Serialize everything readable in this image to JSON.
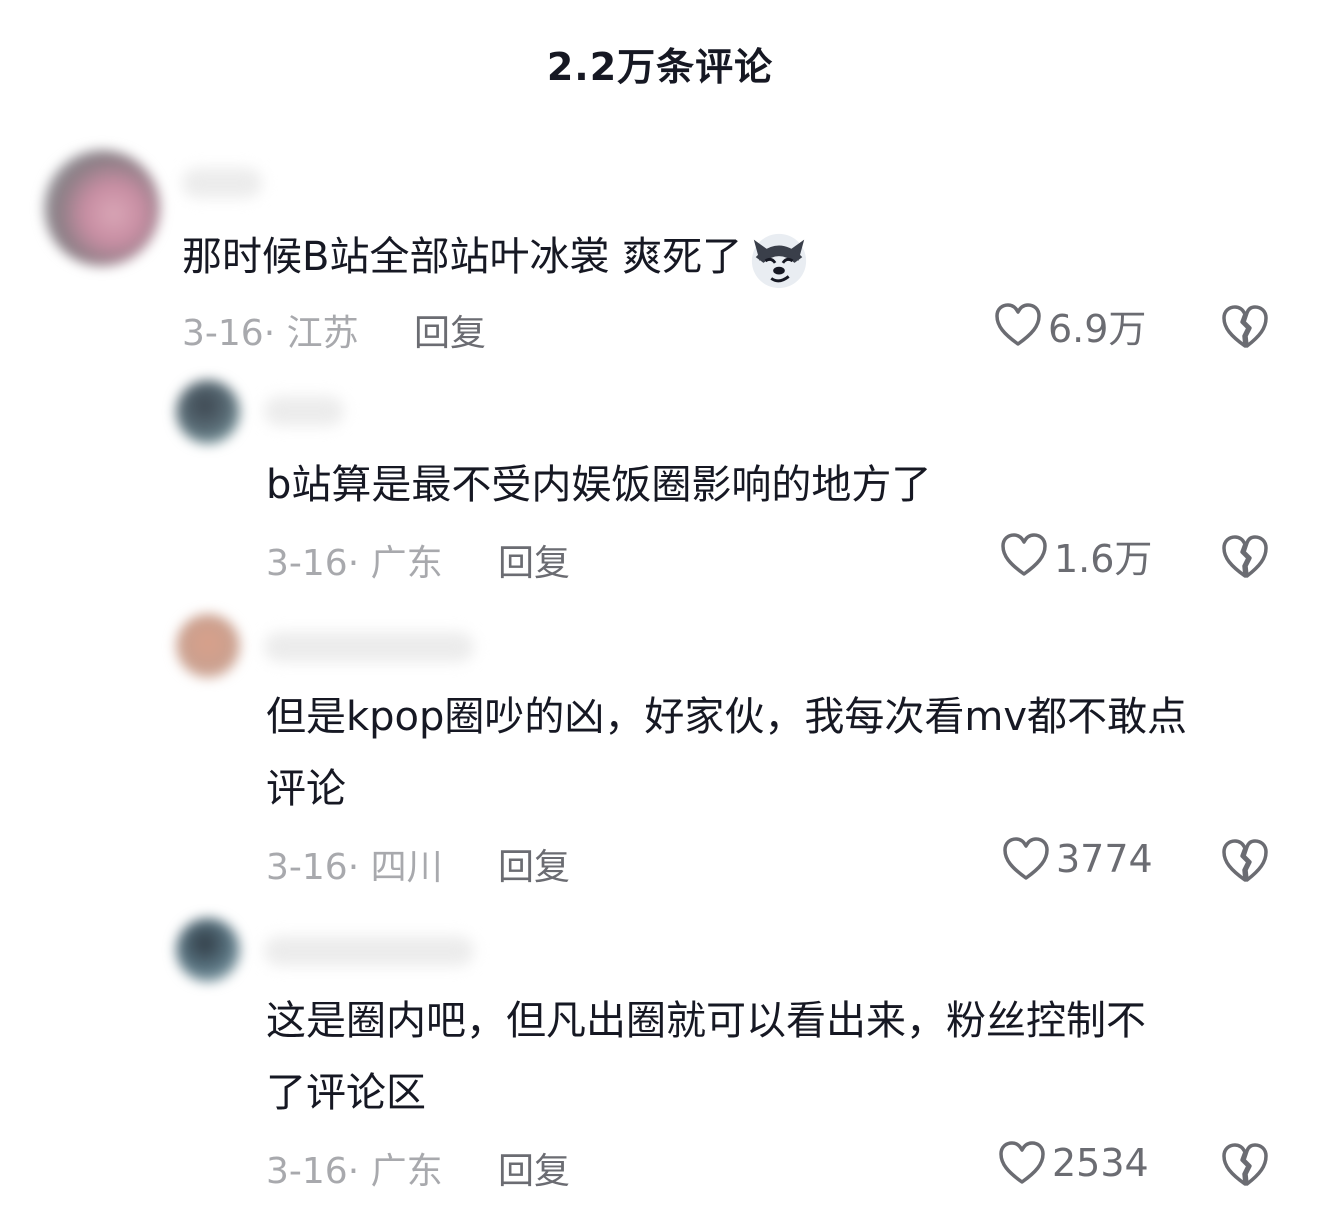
{
  "header": {
    "title": "2.2万条评论"
  },
  "comments": [
    {
      "text": "那时候B站全部站叶冰裳 爽死了",
      "emoji": "husky-smirk-emoji",
      "date_location": "3-16· 江苏",
      "reply_label": "回复",
      "likes": "6.9万"
    },
    {
      "text": "b站算是最不受内娱饭圈影响的地方了",
      "date_location": "3-16· 广东",
      "reply_label": "回复",
      "likes": "1.6万"
    },
    {
      "text_line1": "但是kpop圈吵的凶，好家伙，我每次看mv都不敢点",
      "text_line2": "评论",
      "date_location": "3-16· 四川",
      "reply_label": "回复",
      "likes": "3774"
    },
    {
      "text_line1": "这是圈内吧，但凡出圈就可以看出来，粉丝控制不",
      "text_line2": "了评论区",
      "date_location": "3-16· 广东",
      "reply_label": "回复",
      "likes": "2534"
    }
  ],
  "icons": {
    "like": "heart-outline-icon",
    "dislike": "broken-heart-icon"
  },
  "colors": {
    "text": "#161823",
    "meta": "#a8a9ad",
    "secondary": "#6b6c72"
  }
}
